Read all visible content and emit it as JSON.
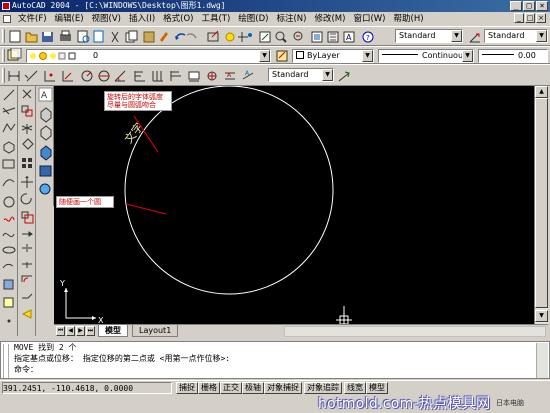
{
  "window": {
    "title": "AutoCAD 2004 - [C:\\WINDOWS\\Desktop\\图形1.dwg]",
    "controls": [
      "_",
      "□",
      "×"
    ]
  },
  "menu": {
    "items": [
      "文件(F)",
      "编辑(E)",
      "视图(V)",
      "插入(I)",
      "格式(O)",
      "工具(T)",
      "绘图(D)",
      "标注(N)",
      "修改(M)",
      "窗口(W)",
      "帮助(H)"
    ],
    "doc_controls": [
      "_",
      "□",
      "×"
    ]
  },
  "toolbar_standard": {
    "text_style": "Standard",
    "dim_style": "Standard"
  },
  "toolbar_layers": {
    "layer_name": "0",
    "color": "ByLayer",
    "linetype": "Continuous",
    "lineweight": "0.00"
  },
  "toolbar_dim": {
    "dim_style": "Standard"
  },
  "drawing": {
    "annotation_top": "旋转后的字体弧度尽量与圆弧吻合",
    "annotation_left": "随便画一个圆",
    "arc_text": "文字",
    "ucs_y": "Y",
    "ucs_x": "X",
    "circle_color": "#ffffff",
    "annotation_color": "#cc0000"
  },
  "tabs": {
    "model": "模型",
    "layout1": "Layout1"
  },
  "command": {
    "line1": "MOVE 找到 2 个",
    "line2": "指定基点或位移：  指定位移的第二点或 <用第一点作位移>:",
    "line3": "命令："
  },
  "status": {
    "coords": "391.2451, -110.4618, 0.0000",
    "buttons": [
      "捕捉",
      "栅格",
      "正交",
      "极轴",
      "对象捕捉",
      "对象追踪",
      "线宽",
      "模型"
    ]
  },
  "watermark": {
    "text": "hotmold.com-热点模具网",
    "sub": "日本电脑"
  }
}
